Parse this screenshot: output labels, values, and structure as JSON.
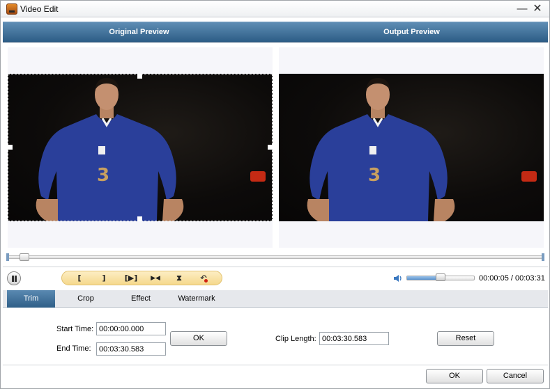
{
  "window": {
    "title": "Video Edit",
    "minimize_glyph": "—",
    "close_glyph": "✕"
  },
  "preview": {
    "original_label": "Original Preview",
    "output_label": "Output Preview"
  },
  "seek": {
    "position_fraction": 0.02
  },
  "controls": {
    "tools": [
      {
        "name": "set-start-tool",
        "glyph": "["
      },
      {
        "name": "set-end-tool",
        "glyph": "]"
      },
      {
        "name": "play-segment-tool",
        "glyph": "[▶]"
      },
      {
        "name": "skip-segment-tool",
        "glyph": "▶◀"
      },
      {
        "name": "merge-tool",
        "glyph": "⧗"
      },
      {
        "name": "undo-tool",
        "glyph": "↶"
      }
    ],
    "volume_fraction": 0.5,
    "time_readout": "00:00:05 / 00:03:31"
  },
  "tabs": [
    {
      "label": "Trim",
      "active": true
    },
    {
      "label": "Crop",
      "active": false
    },
    {
      "label": "Effect",
      "active": false
    },
    {
      "label": "Watermark",
      "active": false
    }
  ],
  "trim": {
    "start_label": "Start Time:",
    "start_value": "00:00:00.000",
    "end_label": "End Time:",
    "end_value": "00:03:30.583",
    "ok_label": "OK",
    "clip_length_label": "Clip Length:",
    "clip_length_value": "00:03:30.583",
    "reset_label": "Reset"
  },
  "footer": {
    "ok_label": "OK",
    "cancel_label": "Cancel"
  },
  "colors": {
    "header_blue": "#2d5d86",
    "tool_bar_yellow": "#f5d88c",
    "jersey_blue": "#2a3f9a"
  }
}
